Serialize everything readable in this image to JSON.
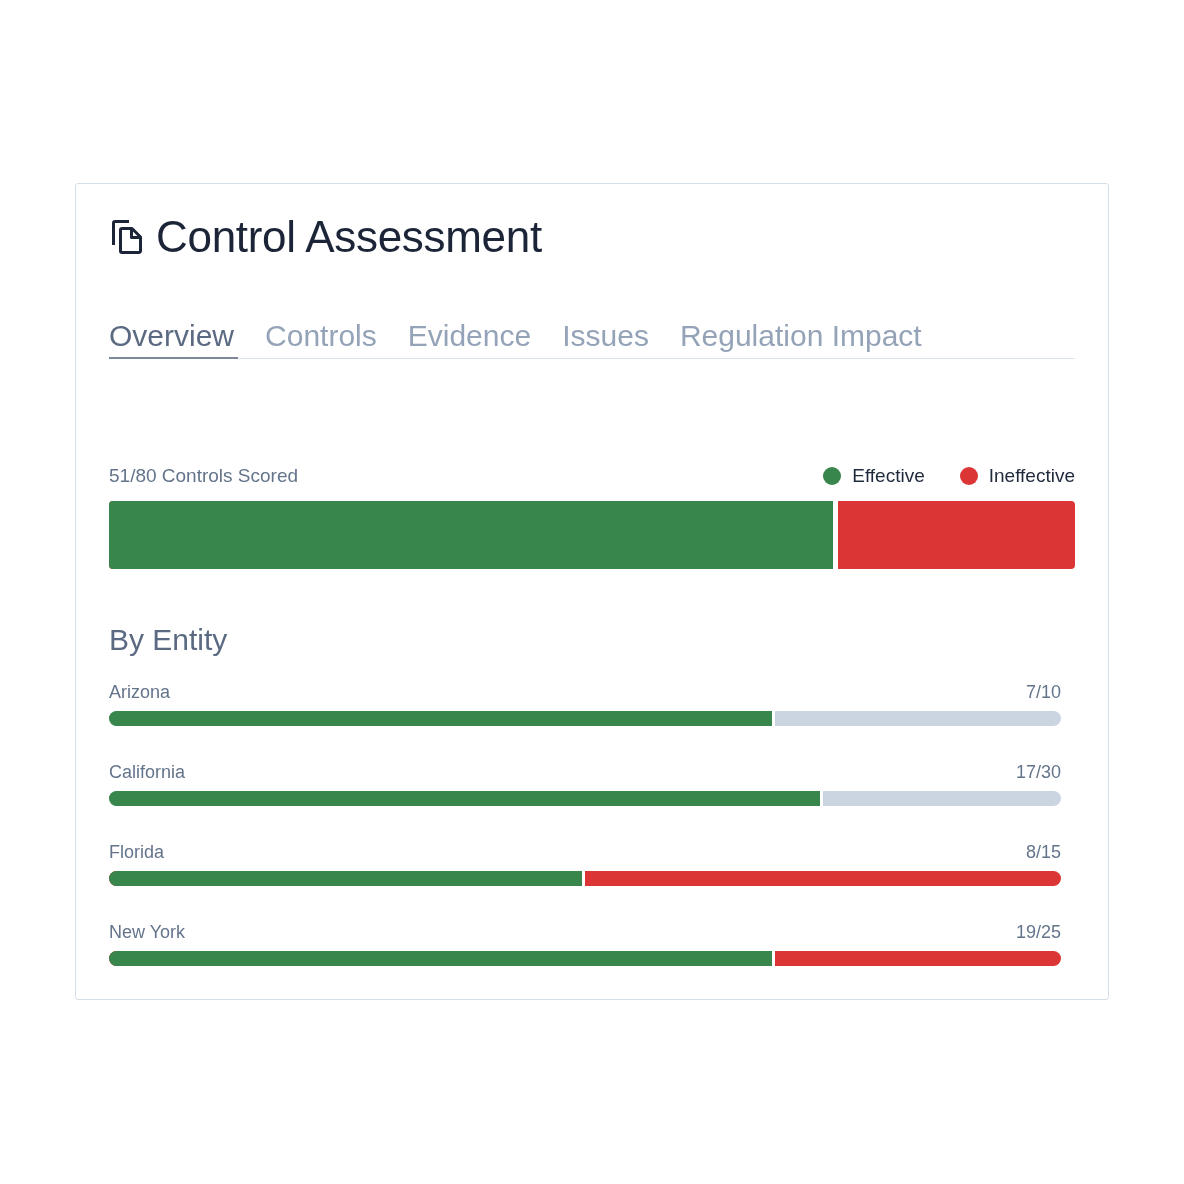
{
  "header": {
    "title": "Control Assessment"
  },
  "tabs": [
    {
      "label": "Overview",
      "selected": true
    },
    {
      "label": "Controls",
      "selected": false
    },
    {
      "label": "Evidence",
      "selected": false
    },
    {
      "label": "Issues",
      "selected": false
    },
    {
      "label": "Regulation Impact",
      "selected": false
    }
  ],
  "summary": {
    "label": "51/80 Controls Scored",
    "legend": [
      {
        "label": "Effective",
        "color": "#38864b"
      },
      {
        "label": "Ineffective",
        "color": "#dc3535"
      }
    ],
    "bar": {
      "level": 0.755
    }
  },
  "by_entity": {
    "title": "By Entity",
    "entities": [
      {
        "name": "Arizona",
        "score": "7/10",
        "level": 0.7,
        "has_ineffective": false
      },
      {
        "name": "California",
        "score": "17/30",
        "level": 0.75,
        "has_ineffective": false
      },
      {
        "name": "Florida",
        "score": "8/15",
        "level": 0.5,
        "has_ineffective": true
      },
      {
        "name": "New York",
        "score": "19/25",
        "level": 0.7,
        "has_ineffective": true
      }
    ]
  }
}
